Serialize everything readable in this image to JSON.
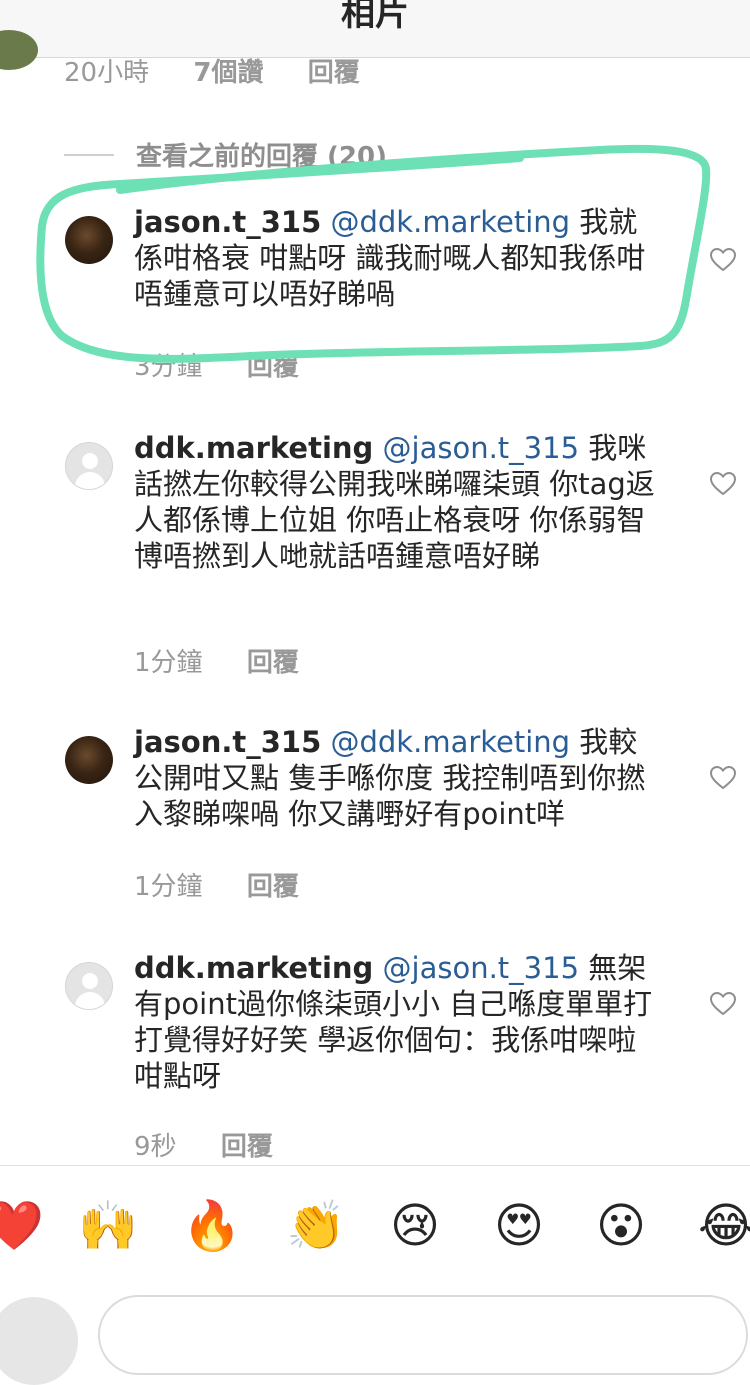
{
  "header": {
    "title": "相片"
  },
  "top_meta": {
    "time": "20小時",
    "likes": "7個讚",
    "reply": "回覆"
  },
  "view_previous": "查看之前的回覆 (20)",
  "comments": [
    {
      "username": "jason.t_315",
      "mention": "@ddk.marketing",
      "text": " 我就係咁格衰 咁點呀 識我耐嘅人都知我係咁 唔鍾意可以唔好睇喎",
      "time": "3分鐘",
      "reply": "回覆",
      "avatar": "user-photo"
    },
    {
      "username": "ddk.marketing",
      "mention": "@jason.t_315",
      "text": " 我咪話撚左你較得公開我咪睇囉柒頭 你tag返人都係博上位姐 你唔止格衰呀 你係弱智 博唔撚到人哋就話唔鍾意唔好睇",
      "time": "1分鐘",
      "reply": "回覆",
      "avatar": "default-avatar"
    },
    {
      "username": "jason.t_315",
      "mention": "@ddk.marketing",
      "text": " 我較公開咁又點 隻手喺你度 我控制唔到你撚入黎睇㗎喎 你又講嘢好有point咩",
      "time": "1分鐘",
      "reply": "回覆",
      "avatar": "user-photo"
    },
    {
      "username": "ddk.marketing",
      "mention": "@jason.t_315",
      "text": " 無架有point過你條柒頭小小 自己喺度單單打打覺得好好笑 學返你個句：我係咁㗎啦 咁點呀",
      "time": "9秒",
      "reply": "回覆",
      "avatar": "default-avatar"
    }
  ],
  "emoji_bar": [
    "❤️",
    "🙌",
    "🔥",
    "👏",
    "😢",
    "😍",
    "😮",
    "😂"
  ],
  "icons": {
    "like": "heart-outline-icon"
  },
  "colors": {
    "mention": "#2b5d95",
    "highlight": "#6de0b5"
  }
}
